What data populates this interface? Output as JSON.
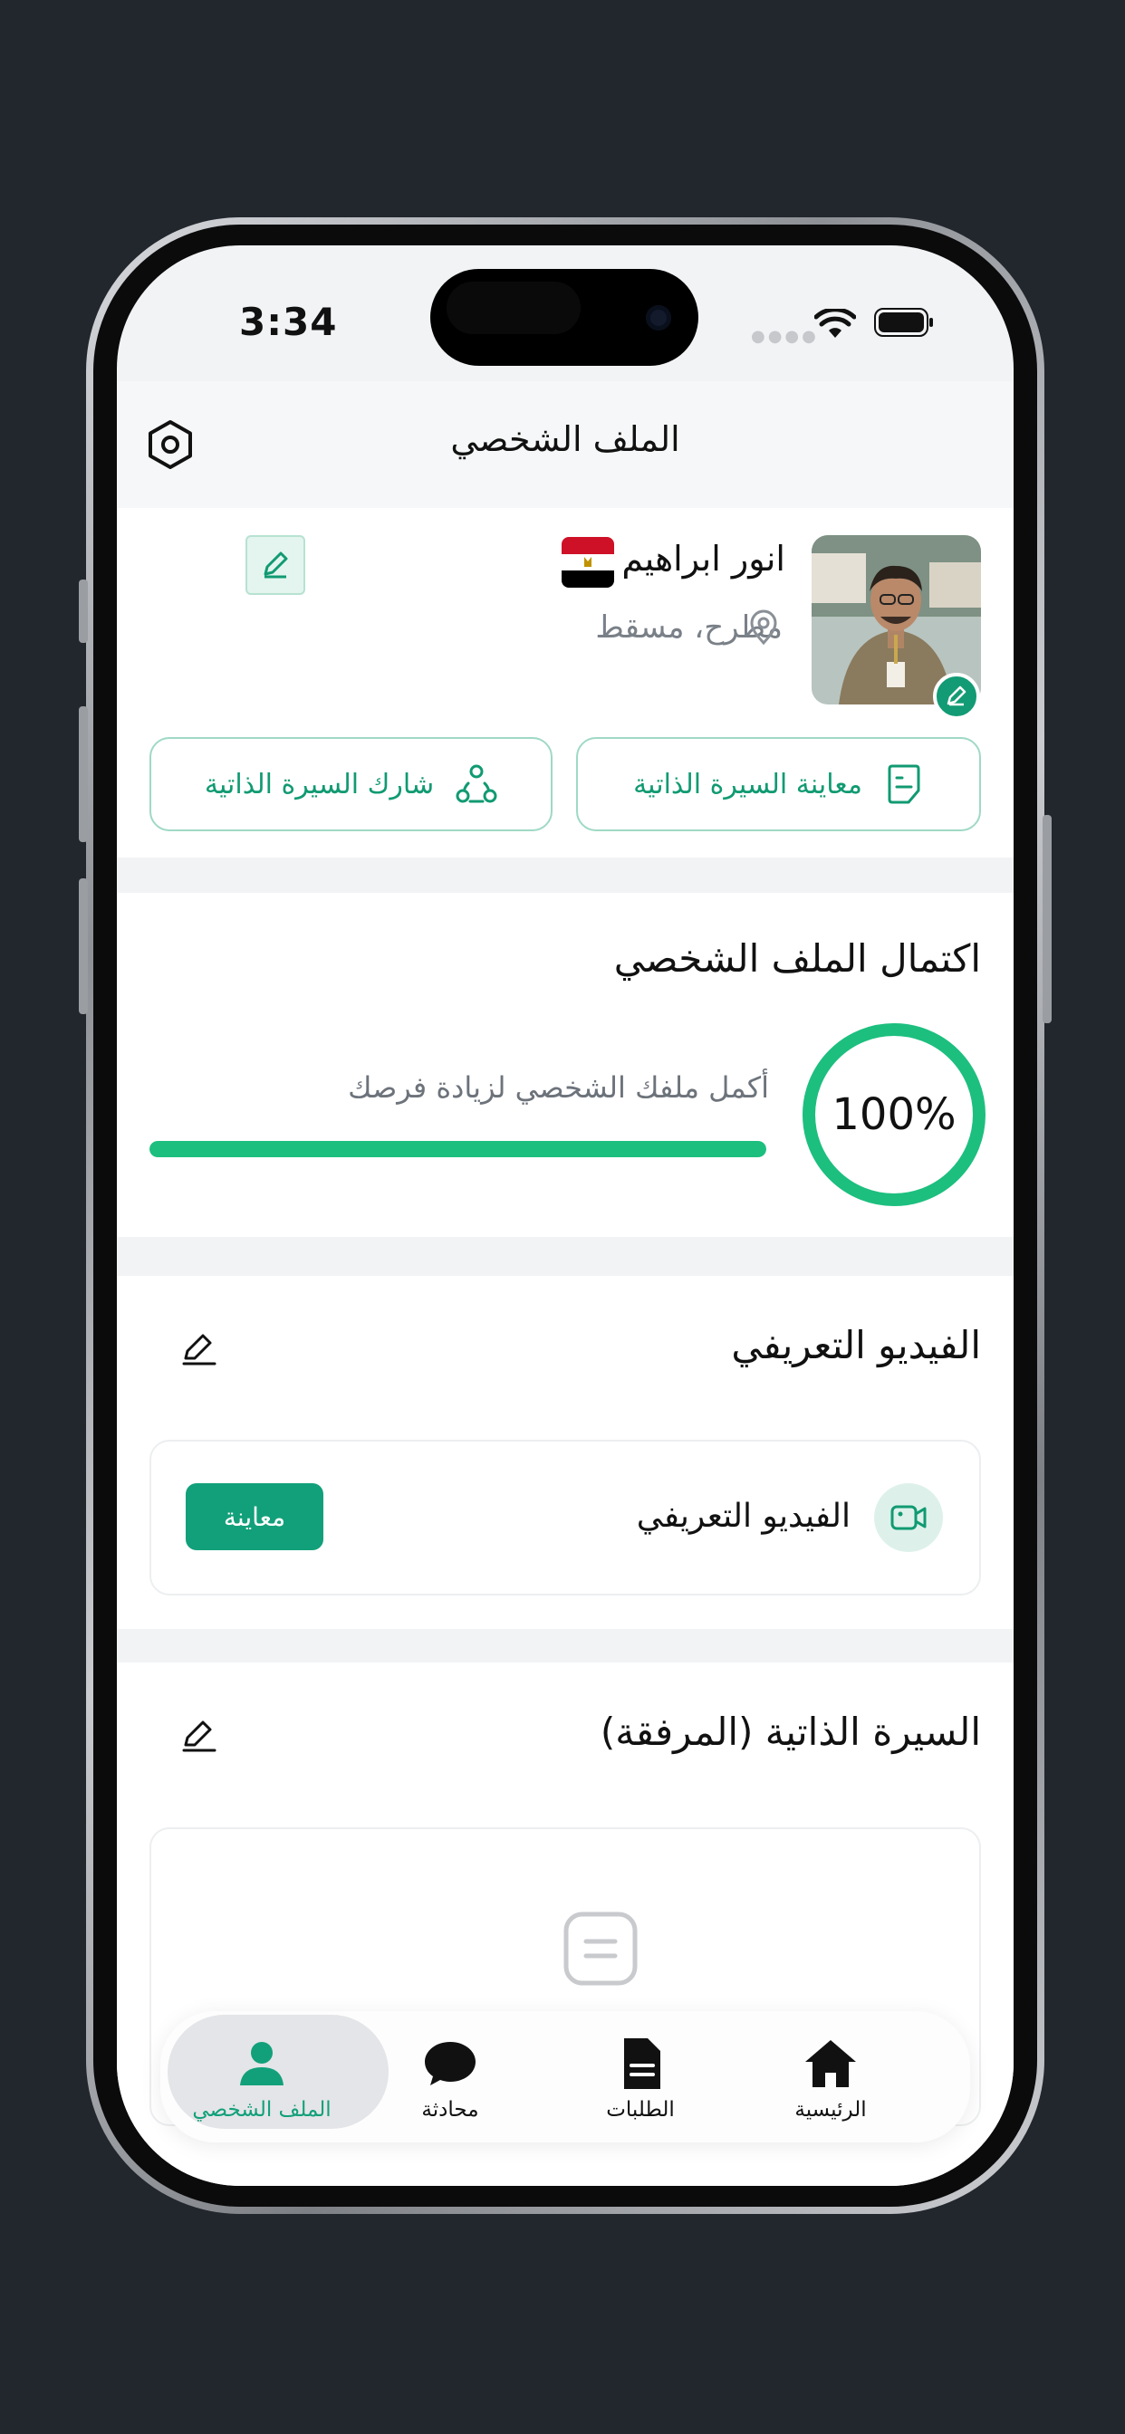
{
  "status_bar": {
    "time": "3:34"
  },
  "header": {
    "title": "الملف الشخصي"
  },
  "profile": {
    "name": "انور ابراهيم",
    "location": "مطرح، مسقط",
    "preview_cv_label": "معاينة السيرة الذاتية",
    "share_cv_label": "شارك السيرة الذاتية"
  },
  "completion": {
    "title": "اكتمال الملف الشخصي",
    "subtitle": "أكمل ملفك الشخصي لزيادة فرصك",
    "percent_label": "100%",
    "percent_value": 100,
    "accent_color": "#1cbf7e"
  },
  "video_section": {
    "title": "الفيديو التعريفي",
    "item_label": "الفيديو التعريفي",
    "preview_button": "معاينة"
  },
  "cv_section": {
    "title": "السيرة الذاتية (المرفقة)"
  },
  "bottom_nav": {
    "items": [
      {
        "label": "الرئيسية",
        "icon": "home-icon"
      },
      {
        "label": "الطلبات",
        "icon": "document-icon"
      },
      {
        "label": "محادثة",
        "icon": "chat-bubble-icon"
      },
      {
        "label": "الملف الشخصي",
        "icon": "person-icon",
        "active": true
      }
    ],
    "active_color": "#12a07a"
  },
  "colors": {
    "brand_green": "#12a07a",
    "background": "#22262d"
  }
}
